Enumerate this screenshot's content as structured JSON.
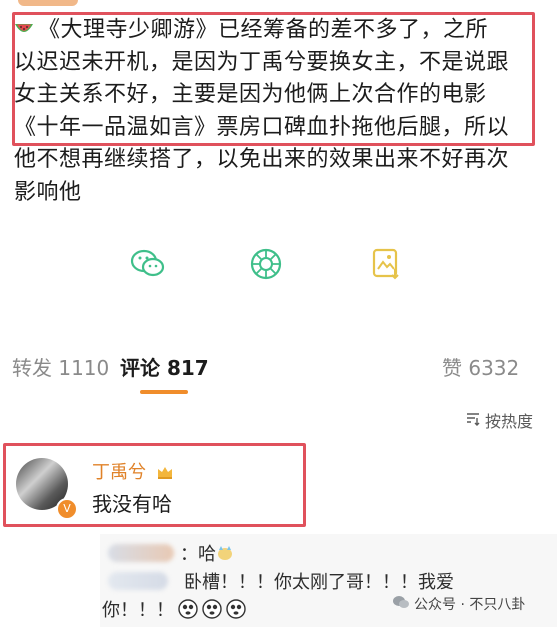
{
  "post": {
    "lines": [
      "《大理寺少卿游》已经筹备的差不多了，之所",
      "以迟迟未开机，是因为丁禹兮要换女主，不是说跟",
      "女主关系不好，主要是因为他俩上次合作的电影",
      "《十年一品温如言》票房口碑血扑拖他后腿，所以",
      "他不想再继续搭了，以免出来的效果出来不好再次",
      "影响他"
    ]
  },
  "actions": [
    {
      "icon": "wechat-icon"
    },
    {
      "icon": "moments-icon"
    },
    {
      "icon": "save-image-icon"
    }
  ],
  "tabs": {
    "repost": "转发 1110",
    "comments": "评论 817",
    "likes": "赞 6332"
  },
  "sort": {
    "label": "按热度"
  },
  "comment": {
    "name": "丁禹兮",
    "text": "我没有哈"
  },
  "replies": {
    "r1_text": "：哈",
    "r2_text": "卧槽！！！你太刚了哥！！！我爱",
    "r3_text": "你！！！"
  },
  "watermark": {
    "label": "公众号 · 不只八卦"
  },
  "colors": {
    "highlight": "#e0515c",
    "accent": "#f08d2b",
    "icon_green": "#3fbf8a",
    "icon_yellow": "#e6c34a"
  }
}
